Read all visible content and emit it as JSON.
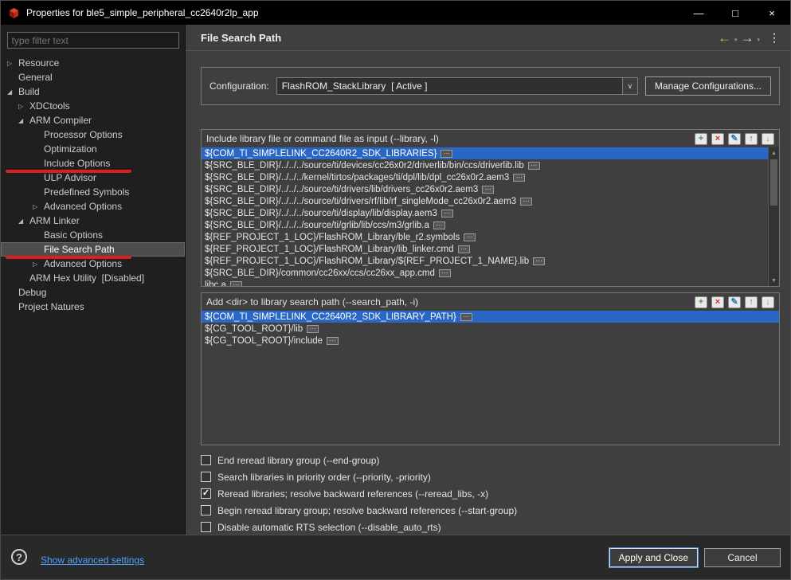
{
  "window": {
    "title": "Properties for ble5_simple_peripheral_cc2640r2lp_app",
    "minimize_glyph": "—",
    "maximize_glyph": "□",
    "close_glyph": "×"
  },
  "sidebar": {
    "filter_placeholder": "type filter text",
    "tree": [
      {
        "label": "Resource",
        "level": 0,
        "arrow": "collapsed"
      },
      {
        "label": "General",
        "level": 0
      },
      {
        "label": "Build",
        "level": 0,
        "arrow": "expanded"
      },
      {
        "label": "XDCtools",
        "level": 1,
        "arrow": "collapsed"
      },
      {
        "label": "ARM Compiler",
        "level": 1,
        "arrow": "expanded"
      },
      {
        "label": "Processor Options",
        "level": 2
      },
      {
        "label": "Optimization",
        "level": 2
      },
      {
        "label": "Include Options",
        "level": 2,
        "annotated": true
      },
      {
        "label": "ULP Advisor",
        "level": 2
      },
      {
        "label": "Predefined Symbols",
        "level": 2
      },
      {
        "label": "Advanced Options",
        "level": 2,
        "arrow": "collapsed"
      },
      {
        "label": "ARM Linker",
        "level": 1,
        "arrow": "expanded"
      },
      {
        "label": "Basic Options",
        "level": 2
      },
      {
        "label": "File Search Path",
        "level": 2,
        "selected": true,
        "annotated": true
      },
      {
        "label": "Advanced Options",
        "level": 2,
        "arrow": "collapsed"
      },
      {
        "label": "ARM Hex Utility  [Disabled]",
        "level": 1
      },
      {
        "label": "Debug",
        "level": 0
      },
      {
        "label": "Project Natures",
        "level": 0
      }
    ]
  },
  "header": {
    "title": "File Search Path"
  },
  "configuration": {
    "label": "Configuration:",
    "value": "FlashROM_StackLibrary  [ Active ]",
    "manage_button": "Manage Configurations..."
  },
  "toolbar_icons": [
    {
      "name": "add-icon",
      "glyph": "+",
      "color": "#3f9b35"
    },
    {
      "name": "delete-icon",
      "glyph": "×",
      "color": "#c63a2c"
    },
    {
      "name": "edit-icon",
      "glyph": "✎",
      "color": "#2e7fa8"
    },
    {
      "name": "move-up-icon",
      "glyph": "↑",
      "color": "#7a55b0"
    },
    {
      "name": "move-down-icon",
      "glyph": "↓",
      "color": "#b8962f"
    }
  ],
  "library_group": {
    "title": "Include library file or command file as input (--library, -l)",
    "selected_index": 0,
    "items": [
      "${COM_TI_SIMPLELINK_CC2640R2_SDK_LIBRARIES}",
      "${SRC_BLE_DIR}/../../../source/ti/devices/cc26x0r2/driverlib/bin/ccs/driverlib.lib",
      "${SRC_BLE_DIR}/../../../kernel/tirtos/packages/ti/dpl/lib/dpl_cc26x0r2.aem3",
      "${SRC_BLE_DIR}/../../../source/ti/drivers/lib/drivers_cc26x0r2.aem3",
      "${SRC_BLE_DIR}/../../../source/ti/drivers/rf/lib/rf_singleMode_cc26x0r2.aem3",
      "${SRC_BLE_DIR}/../../../source/ti/display/lib/display.aem3",
      "${SRC_BLE_DIR}/../../../source/ti/grlib/lib/ccs/m3/grlib.a",
      "${REF_PROJECT_1_LOC}/FlashROM_Library/ble_r2.symbols",
      "${REF_PROJECT_1_LOC}/FlashROM_Library/lib_linker.cmd",
      "${REF_PROJECT_1_LOC}/FlashROM_Library/${REF_PROJECT_1_NAME}.lib",
      "${SRC_BLE_DIR}/common/cc26xx/ccs/cc26xx_app.cmd",
      "libc.a"
    ]
  },
  "search_path_group": {
    "title": "Add <dir> to library search path (--search_path, -i)",
    "selected_index": 0,
    "items": [
      "${COM_TI_SIMPLELINK_CC2640R2_SDK_LIBRARY_PATH}",
      "${CG_TOOL_ROOT}/lib",
      "${CG_TOOL_ROOT}/include"
    ]
  },
  "checkboxes": [
    {
      "label": "End reread library group (--end-group)",
      "checked": false
    },
    {
      "label": "Search libraries in priority order (--priority, -priority)",
      "checked": false
    },
    {
      "label": "Reread libraries; resolve backward references (--reread_libs, -x)",
      "checked": true
    },
    {
      "label": "Begin reread library group; resolve backward references (--start-group)",
      "checked": false
    },
    {
      "label": "Disable automatic RTS selection (--disable_auto_rts)",
      "checked": false
    }
  ],
  "footer": {
    "help_glyph": "?",
    "link": "Show advanced settings",
    "apply_button": "Apply and Close",
    "cancel_button": "Cancel"
  },
  "icons": {
    "tree_expanded": "◢",
    "tree_collapsed": "▷",
    "back_arrow": "←",
    "forward_arrow": "→",
    "chevron_down": "▾",
    "menu_dots": "⋮",
    "dropdown_chevron": "∨",
    "variable_badge": "···",
    "check": "✓",
    "scroll_up": "▲",
    "scroll_down": "▼"
  },
  "colors": {
    "selection_blue": "#2a67c5",
    "annotation_red": "#de1d1d",
    "link_blue": "#4ca1ff",
    "back_arrow_gold": "#e2b64f",
    "titlebar_black": "#000000",
    "sidebar_dark": "#1f1f1f",
    "panel_gray": "#3f3f3f"
  }
}
